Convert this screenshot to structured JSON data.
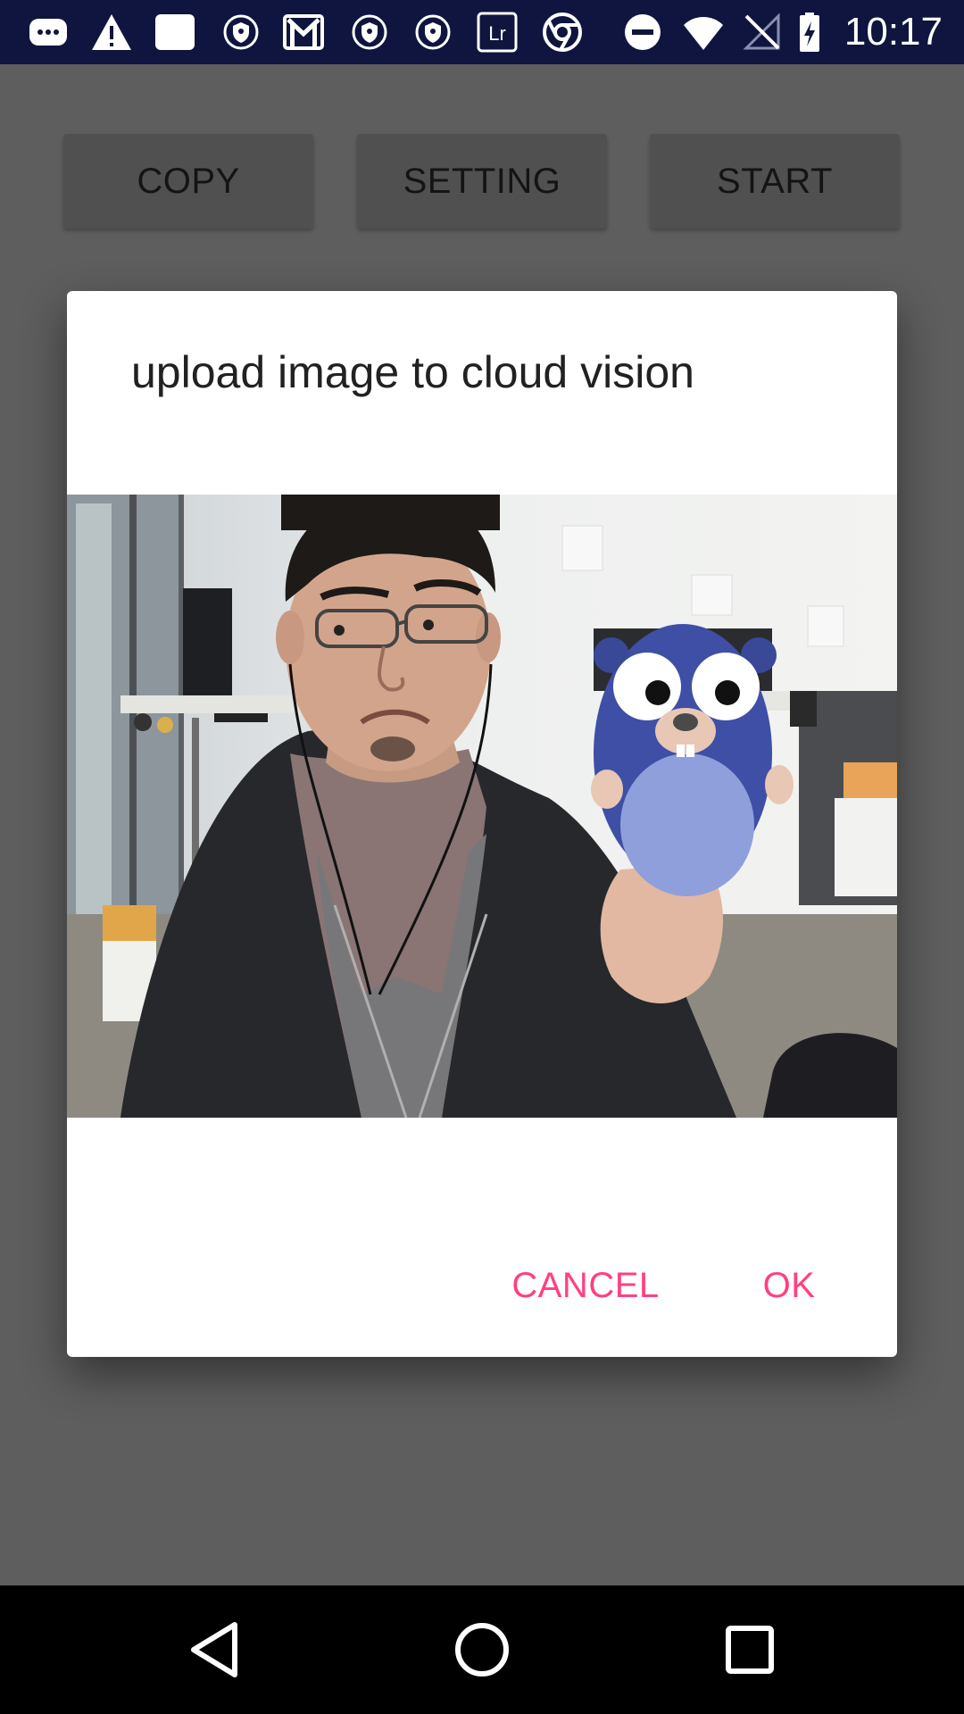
{
  "status_bar": {
    "time": "10:17",
    "icons": [
      "messages-icon",
      "warning-icon",
      "blank-notification-icon",
      "vpn-shield-icon",
      "gmail-icon",
      "vpn-shield-icon",
      "vpn-shield-icon",
      "lightroom-icon",
      "chrome-icon",
      "do-not-disturb-icon",
      "wifi-icon",
      "no-signal-icon",
      "battery-charging-icon"
    ],
    "lightroom_text": "Lr",
    "background_color": "#0f153e"
  },
  "app": {
    "buttons": {
      "copy_label": "COPY",
      "setting_label": "SETTING",
      "start_label": "START"
    },
    "scrim_color": "#5e5e5e"
  },
  "dialog": {
    "title": "upload image to cloud vision",
    "image_icon": "photo-person-holding-gopher-plush",
    "cancel_label": "CANCEL",
    "ok_label": "OK",
    "accent_color": "#ff4081"
  },
  "nav_bar": {
    "icons": [
      "back-icon",
      "home-icon",
      "recents-icon"
    ]
  }
}
